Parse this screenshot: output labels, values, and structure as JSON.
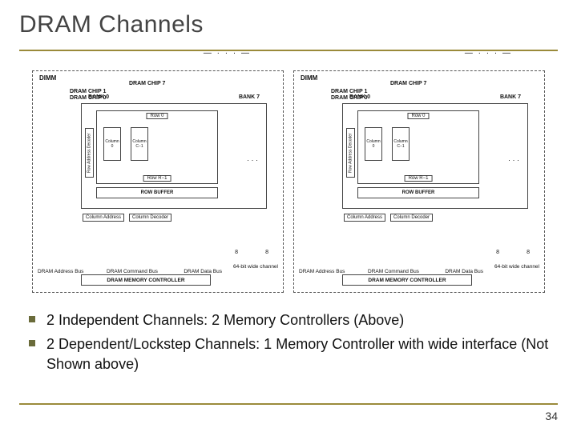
{
  "title": "DRAM Channels",
  "page_number": "34",
  "bullets": [
    "2 Independent Channels: 2 Memory Controllers (Above)",
    "2 Dependent/Lockstep Channels: 1 Memory Controller with wide interface (Not Shown above)"
  ],
  "figure": {
    "dimm_label": "DIMM",
    "chip7_label": "DRAM CHIP 7",
    "chip1_label": "DRAM CHIP 1",
    "chip0_label": "DRAM CHIP 0",
    "bank0_label": "BANK 0",
    "bank7_label": "BANK 7",
    "row0": "Row 0",
    "rowR": "Row R−1",
    "col0": "Column 0",
    "colC": "Column C−1",
    "row_addr_decoder": "Row Address Decoder",
    "col_addr": "Column Address",
    "col_decoder": "Column Decoder",
    "row_buffer": "ROW BUFFER",
    "mem_controller": "DRAM MEMORY CONTROLLER",
    "addr_bus": "DRAM Address Bus",
    "cmd_bus": "DRAM Command Bus",
    "data_bus": "DRAM Data Bus",
    "channel_width": "64-bit wide channel",
    "eight": "8"
  }
}
